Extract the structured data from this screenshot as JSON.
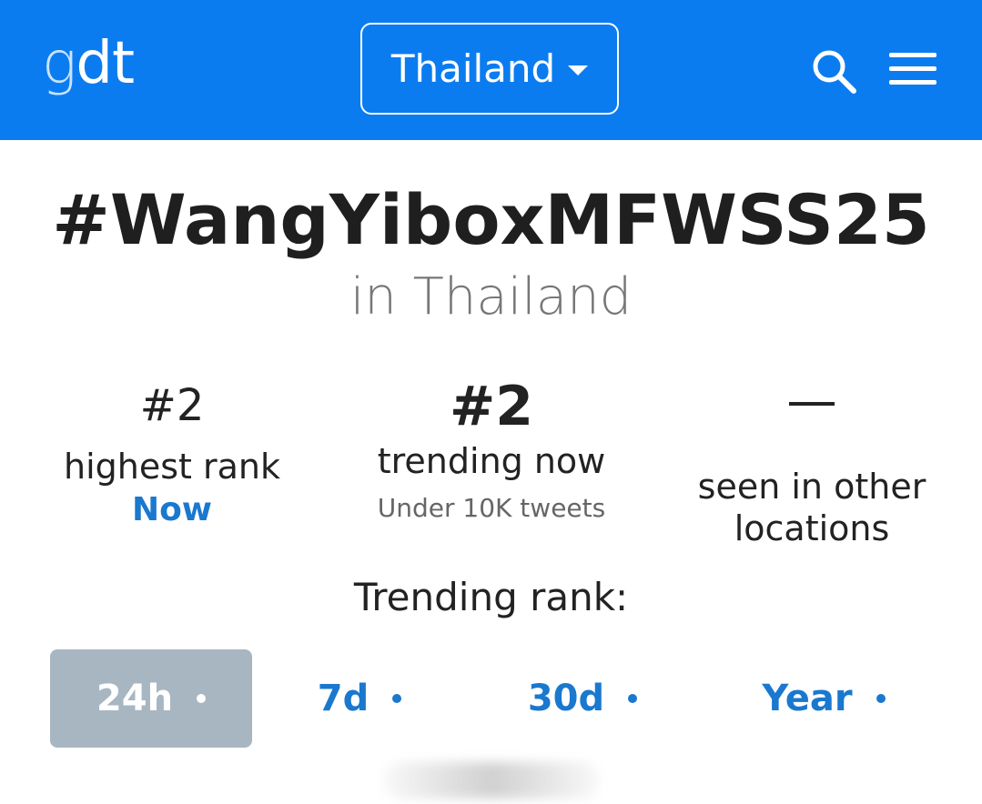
{
  "header": {
    "logo_g": "g",
    "logo_dt": "dt",
    "country": "Thailand",
    "brand_color": "#0b7cf0",
    "icons": [
      "search-icon",
      "menu-icon",
      "chevron-down-icon"
    ]
  },
  "trend": {
    "title": "#WangYiboxMFWSS25",
    "subtitle": "in Thailand"
  },
  "stats": {
    "highest": {
      "value": "#2",
      "label": "highest rank",
      "sub": "Now"
    },
    "current": {
      "value": "#2",
      "label": "trending now",
      "sub": "Under 10K tweets"
    },
    "other": {
      "value": "—",
      "label_line1": "seen in other",
      "label_line2": "locations"
    }
  },
  "ranking": {
    "title": "Trending rank:",
    "tabs": [
      "24h",
      "7d",
      "30d",
      "Year"
    ],
    "active_tab": "24h"
  },
  "colors": {
    "link": "#1a78cf",
    "active_tab_bg": "#a8b6c2"
  }
}
